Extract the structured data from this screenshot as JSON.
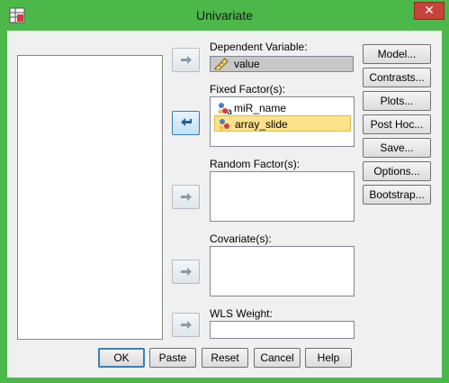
{
  "window": {
    "title": "Univariate",
    "close_label": "✕"
  },
  "fields": {
    "dependent": {
      "label": "Dependent Variable:",
      "value": "value"
    },
    "fixed": {
      "label": "Fixed Factor(s):",
      "items": [
        "miR_name",
        "array_slide"
      ],
      "selected_index": 1
    },
    "random": {
      "label": "Random Factor(s):"
    },
    "covariate": {
      "label": "Covariate(s):"
    },
    "wls": {
      "label": "WLS Weight:"
    }
  },
  "side_buttons": [
    "Model...",
    "Contrasts...",
    "Plots...",
    "Post Hoc...",
    "Save...",
    "Options...",
    "Bootstrap..."
  ],
  "bottom_buttons": [
    "OK",
    "Paste",
    "Reset",
    "Cancel",
    "Help"
  ],
  "colors": {
    "title_bar": "#4cb84a",
    "close": "#c94338",
    "selection": "#fde28c"
  }
}
